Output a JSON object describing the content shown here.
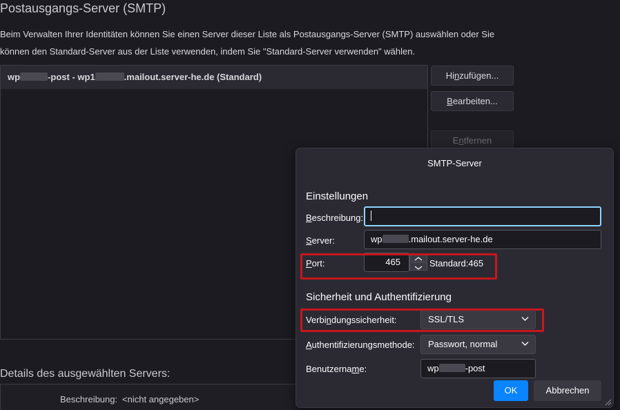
{
  "background": {
    "title": "Postausgangs-Server (SMTP)",
    "description_line1": "Beim Verwalten Ihrer Identitäten können Sie einen Server dieser Liste als Postausgangs-Server (SMTP) auswählen oder Sie",
    "description_line2": "können den Standard-Server aus der Liste verwenden, indem Sie \"Standard-Server verwenden\" wählen.",
    "server_entry": {
      "prefix": "wp",
      "middle": "-post - wp1",
      "suffix": ".mailout.server-he.de (Standard)"
    },
    "buttons": {
      "add_pre": "Hi",
      "add_key": "n",
      "add_post": "zufügen...",
      "edit_key": "B",
      "edit_post": "earbeiten...",
      "remove_pre": "E",
      "remove_key": "n",
      "remove_post": "tfernen"
    },
    "details_title": "Details des ausgewählten Servers:",
    "details_desc_label": "Beschreibung:",
    "details_desc_value": "<nicht angegeben>"
  },
  "dialog": {
    "title": "SMTP-Server",
    "settings_heading": "Einstellungen",
    "description_label_key": "B",
    "description_label_rest": "eschreibung:",
    "description_value": "",
    "server_label_key": "S",
    "server_label_rest": "erver:",
    "server_value_prefix": "wp",
    "server_value_suffix": ".mailout.server-he.de",
    "port_label_key": "P",
    "port_label_rest": "ort:",
    "port_value": "465",
    "port_default": "Standard:465",
    "security_heading": "Sicherheit und Authentifizierung",
    "conn_security_label_pre": "Verbi",
    "conn_security_label_key": "n",
    "conn_security_label_post": "dungssicherheit:",
    "conn_security_value": "SSL/TLS",
    "auth_label_key": "A",
    "auth_label_rest": "uthentifizierungsmethode:",
    "auth_value": "Passwort, normal",
    "username_label_pre": "Benutzerna",
    "username_label_key": "m",
    "username_label_post": "e:",
    "username_value_prefix": "wp",
    "username_value_suffix": "-post",
    "ok_label": "OK",
    "cancel_label": "Abbrechen"
  },
  "colors": {
    "accent": "#0a84ff",
    "highlight_red": "#c8161d",
    "focus_ring": "#8fd4ff"
  },
  "icons": [
    "chevron-down-icon",
    "spin-up-icon",
    "spin-down-icon",
    "resize-grip-icon"
  ]
}
